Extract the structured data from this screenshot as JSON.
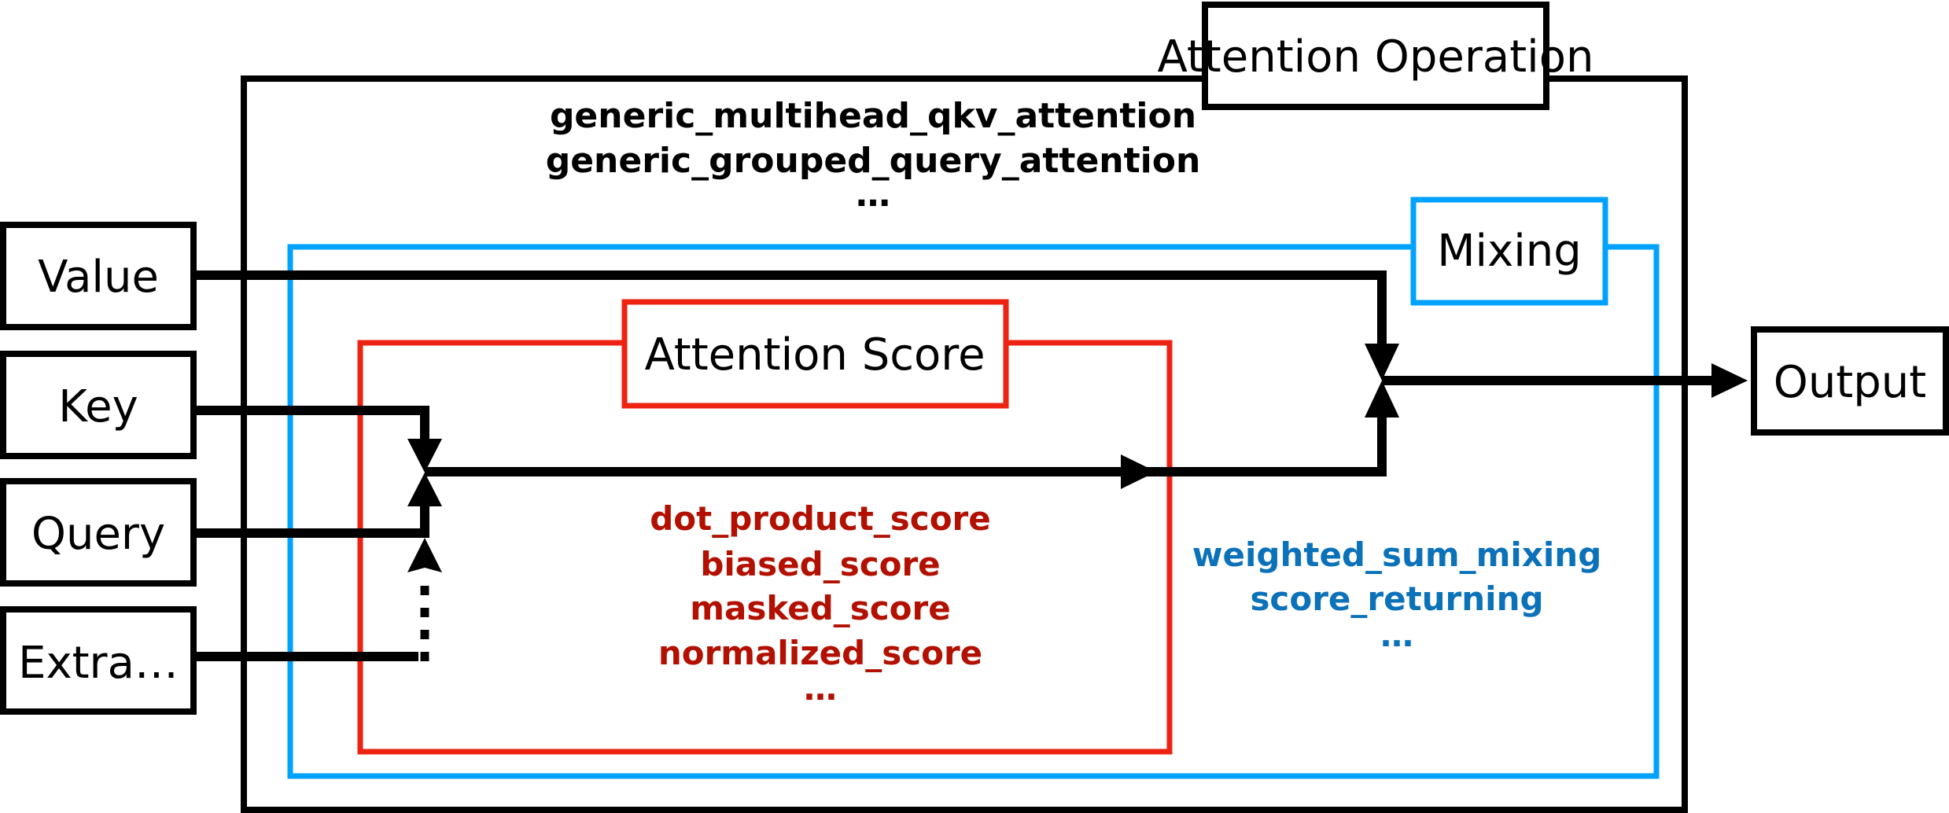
{
  "title": "Attention Operation",
  "operation": {
    "label": "Attention Operation",
    "examples": [
      "generic_multihead_qkv_attention",
      "generic_grouped_query_attention",
      "…"
    ]
  },
  "mixing": {
    "label": "Mixing",
    "color": "#00a2ff",
    "text_color": "#0b72b9",
    "examples": [
      "weighted_sum_mixing",
      "score_returning",
      "…"
    ]
  },
  "score": {
    "label": "Attention Score",
    "color": "#ee2211",
    "text_color": "#b21000",
    "examples": [
      "dot_product_score",
      "biased_score",
      "masked_score",
      "normalized_score",
      "…"
    ]
  },
  "inputs": [
    {
      "id": "value",
      "label": "Value"
    },
    {
      "id": "key",
      "label": "Key"
    },
    {
      "id": "query",
      "label": "Query"
    },
    {
      "id": "extra",
      "label": "Extra…"
    }
  ],
  "output": {
    "label": "Output"
  },
  "edges": [
    {
      "from": "Value",
      "to": "Mixing",
      "style": "solid"
    },
    {
      "from": "Key",
      "to": "Attention Score",
      "style": "solid"
    },
    {
      "from": "Query",
      "to": "Attention Score",
      "style": "solid"
    },
    {
      "from": "Extra…",
      "to": "Attention Score",
      "style": "dotted"
    },
    {
      "from": "Attention Score",
      "to": "Mixing",
      "style": "solid"
    },
    {
      "from": "Mixing",
      "to": "Output",
      "style": "solid"
    }
  ]
}
